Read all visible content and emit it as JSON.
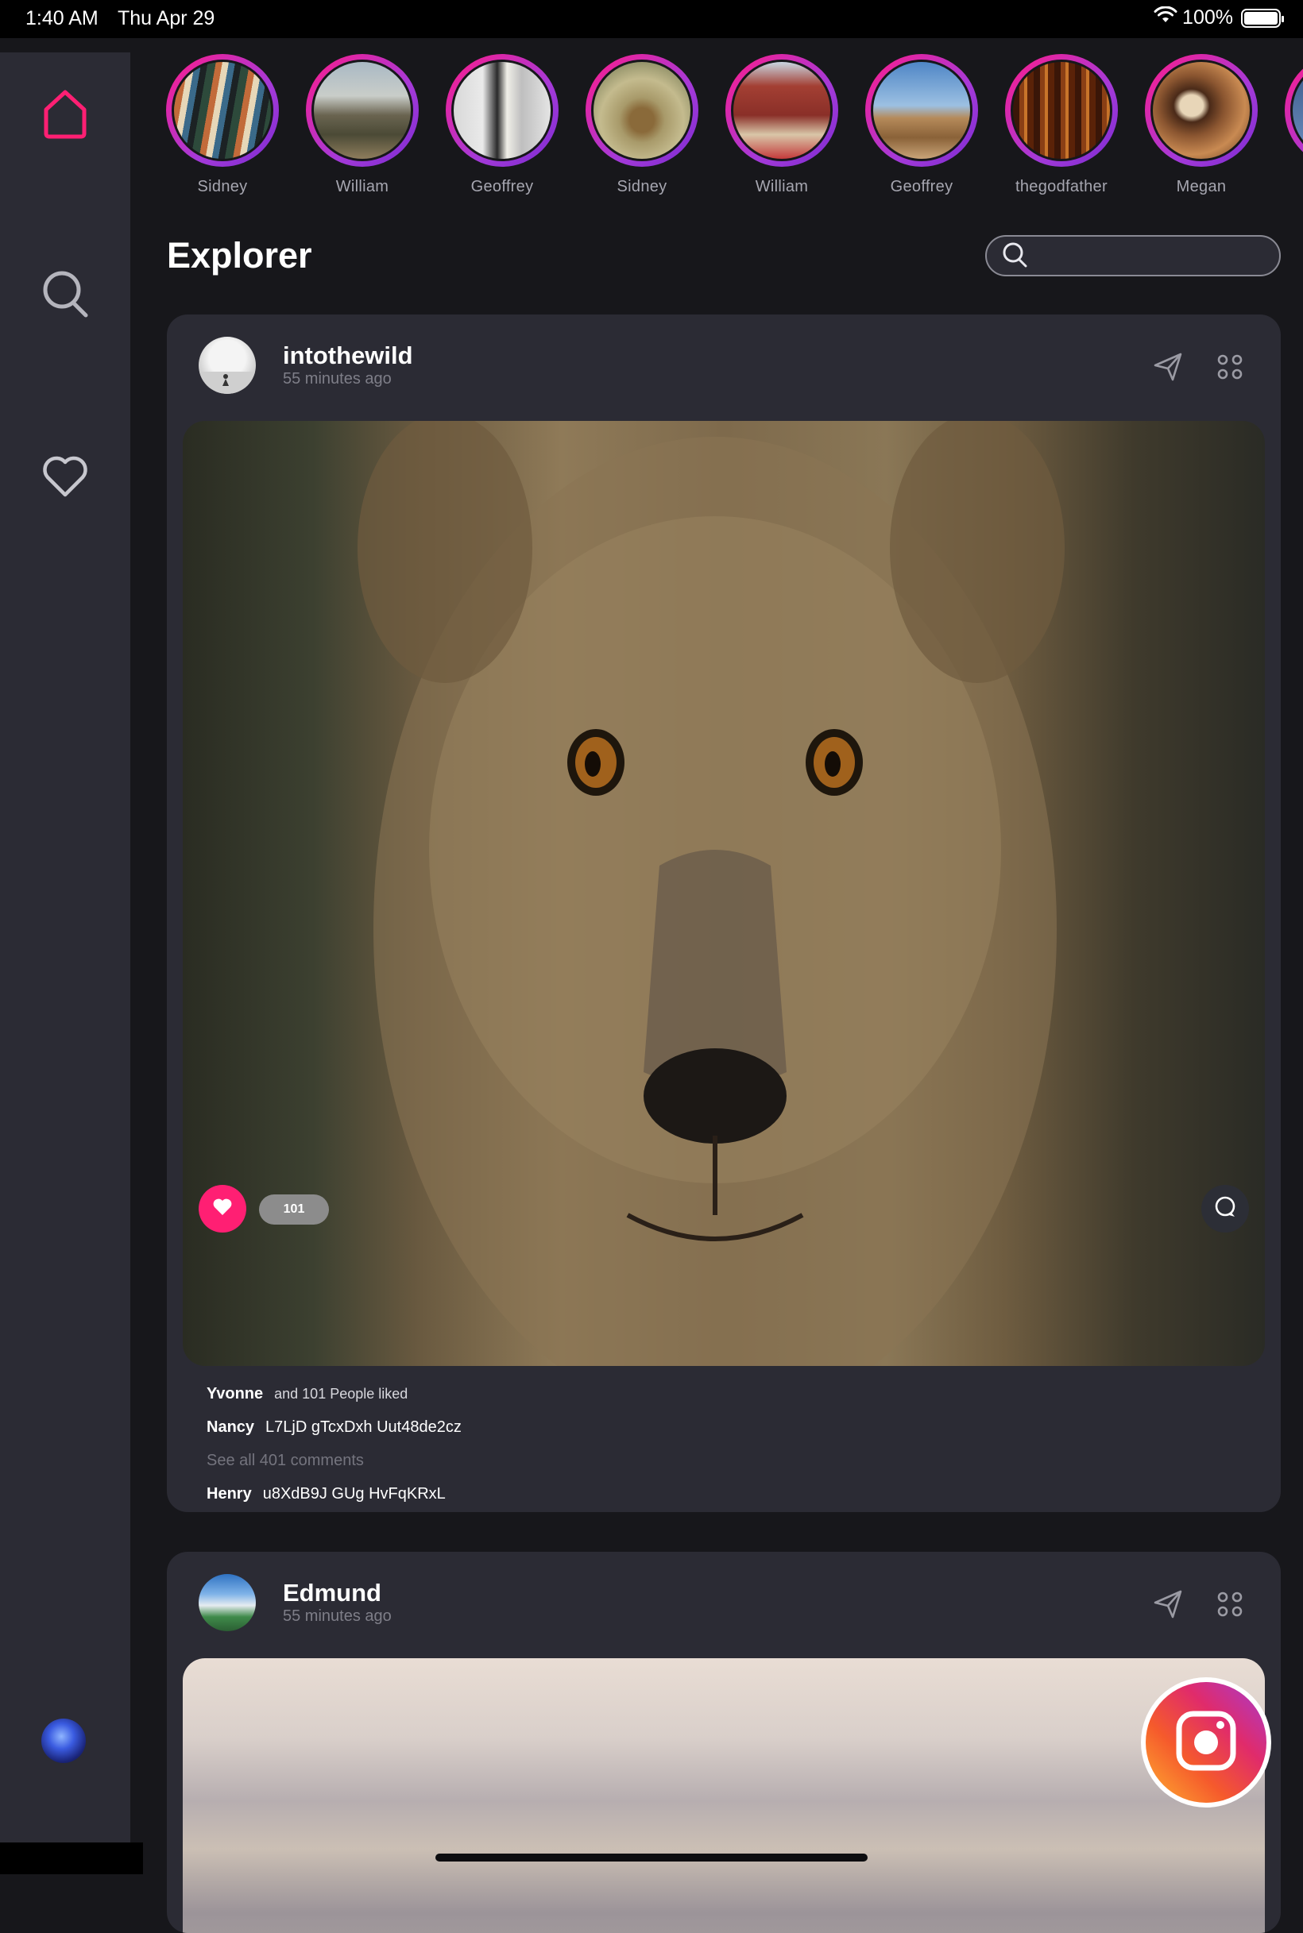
{
  "status_bar": {
    "time": "1:40 AM",
    "date": "Thu Apr 29",
    "battery": "100%"
  },
  "sidebar": {
    "items": [
      {
        "icon": "home-icon",
        "active": true
      },
      {
        "icon": "search-icon",
        "active": false
      },
      {
        "icon": "heart-icon",
        "active": false
      }
    ],
    "accent_color": "#ff1f73"
  },
  "stories": [
    {
      "name": "Sidney"
    },
    {
      "name": "William"
    },
    {
      "name": "Geoffrey"
    },
    {
      "name": "Sidney"
    },
    {
      "name": "William"
    },
    {
      "name": "Geoffrey"
    },
    {
      "name": "thegodfather"
    },
    {
      "name": "Megan"
    }
  ],
  "page": {
    "title": "Explorer",
    "search_placeholder": ""
  },
  "posts": [
    {
      "user": "intothewild",
      "time": "55 minutes ago",
      "likes": "101",
      "liked_by": "Yvonne",
      "liked_text": "and 101 People liked",
      "comment1_user": "Nancy",
      "comment1_text": "L7LjD gTcxDxh Uut48de2cz",
      "see_all": "See all 401 comments",
      "comment2_user": "Henry",
      "comment2_text": "u8XdB9J GUg HvFqKRxL"
    },
    {
      "user": "Edmund",
      "time": "55 minutes ago"
    }
  ]
}
